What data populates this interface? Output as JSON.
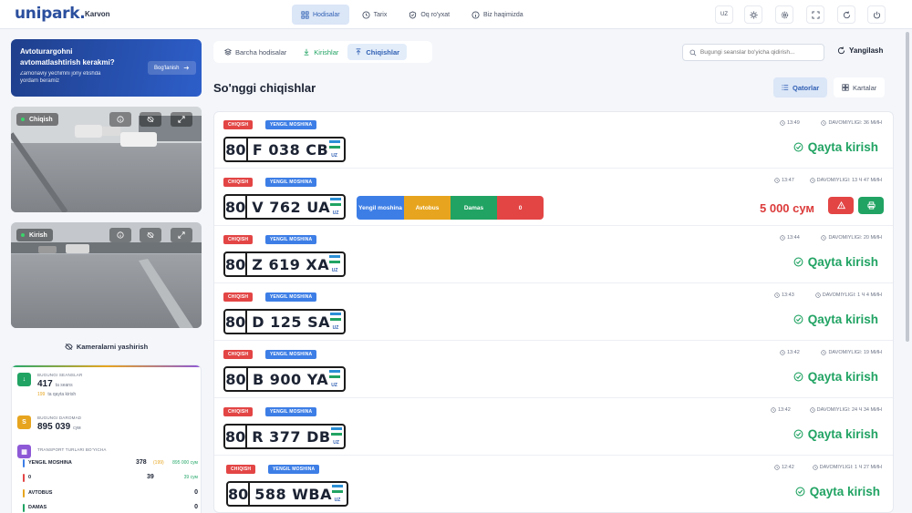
{
  "app": {
    "logo": "unipark",
    "location": "Karvon"
  },
  "nav": [
    {
      "label": "Hodisalar",
      "icon": "grid-icon",
      "active": true
    },
    {
      "label": "Tarix",
      "icon": "history-icon",
      "active": false
    },
    {
      "label": "Oq ro'yxat",
      "icon": "shield-icon",
      "active": false
    },
    {
      "label": "Biz haqimizda",
      "icon": "info-icon",
      "active": false
    }
  ],
  "topbar": {
    "lang": "UZ"
  },
  "promo": {
    "title": "Avtoturargohni avtomatlashtirish kerakmi?",
    "subtitle": "Zamonaviy yechimni joriy etishda yordam beramiz",
    "button": "Bog'lanish"
  },
  "cameras": [
    {
      "label": "Chiqish"
    },
    {
      "label": "Kirish"
    }
  ],
  "hide_cameras": "Kameralarni yashirish",
  "stats": {
    "sessions": {
      "caption": "BUGUNGI SEANSLAR",
      "value": "417",
      "unit": "ta seans",
      "sub_value": "199",
      "sub_label": "ta qayta kirish"
    },
    "income": {
      "caption": "BUGUNGI DAROMAD",
      "value": "895 039",
      "unit": "сум"
    },
    "transport": {
      "caption": "TRANSPORT TURLARI BO'YICHA",
      "rows": [
        {
          "name": "YENGIL MOSHINA",
          "count": "378",
          "extra": "(199)",
          "sum": "895 000 сум",
          "color": "#3d7ee6"
        },
        {
          "name": "0",
          "count": "39",
          "sum": "39 сум",
          "color": "#e34545"
        },
        {
          "name": "AVTOBUS",
          "count": "0",
          "color": "#e7a51f"
        },
        {
          "name": "DAMAS",
          "count": "0",
          "color": "#21a363"
        }
      ]
    }
  },
  "filters": [
    {
      "label": "Barcha hodisalar",
      "icon": "layers-icon",
      "active": false
    },
    {
      "label": "Kirishlar",
      "icon": "arrow-down-icon",
      "active": false
    },
    {
      "label": "Chiqishlar",
      "icon": "arrow-up-icon",
      "active": true
    }
  ],
  "search": {
    "placeholder": "Bugungi seanslar bo'yicha qidirish..."
  },
  "refresh": "Yangilash",
  "section_title": "So'nggi chiqishlar",
  "views": [
    {
      "label": "Qatorlar",
      "icon": "list-icon",
      "active": true
    },
    {
      "label": "Kartalar",
      "icon": "cards-icon",
      "active": false
    }
  ],
  "events": [
    {
      "badge_dir": "CHIQISH",
      "badge_type": "YENGIL MOSHINA",
      "region": "80",
      "number": "F 038 CB",
      "time": "13:49",
      "duration": "DAVOMIYLIGI: 36 МИН",
      "status": "Qayta kirish"
    },
    {
      "badge_dir": "CHIQISH",
      "badge_type": "YENGIL MOSHINA",
      "region": "80",
      "number": "V 762 UA",
      "time": "13:47",
      "duration": "DAVOMIYLIGI: 13 Ч 47 МИН",
      "types": [
        {
          "label": "Yengil moshina",
          "color": "#3d7ee6"
        },
        {
          "label": "Avtobus",
          "color": "#e7a51f"
        },
        {
          "label": "Damas",
          "color": "#21a363"
        },
        {
          "label": "0",
          "color": "#e34545"
        }
      ],
      "price": "5 000 сум"
    },
    {
      "badge_dir": "CHIQISH",
      "badge_type": "YENGIL MOSHINA",
      "region": "80",
      "number": "Z 619 XA",
      "time": "13:44",
      "duration": "DAVOMIYLIGI: 20 МИН",
      "status": "Qayta kirish"
    },
    {
      "badge_dir": "CHIQISH",
      "badge_type": "YENGIL MOSHINA",
      "region": "80",
      "number": "D 125 SA",
      "time": "13:43",
      "duration": "DAVOMIYLIGI: 1 Ч 4 МИН",
      "status": "Qayta kirish"
    },
    {
      "badge_dir": "CHIQISH",
      "badge_type": "YENGIL MOSHINA",
      "region": "80",
      "number": "B 900 YA",
      "time": "13:42",
      "duration": "DAVOMIYLIGI: 19 МИН",
      "status": "Qayta kirish"
    },
    {
      "badge_dir": "CHIQISH",
      "badge_type": "YENGIL MOSHINA",
      "region": "80",
      "number": "R 377 DB",
      "time": "13:42",
      "duration": "DAVOMIYLIGI: 24 Ч 34 МИН",
      "status": "Qayta kirish"
    },
    {
      "badge_dir": "CHIQISH",
      "badge_type": "YENGIL MOSHINA",
      "region": "80",
      "number": "588 WBA",
      "time": "12:42",
      "duration": "DAVOMIYLIGI: 1 Ч 27 МИН",
      "status": "Qayta kirish"
    }
  ],
  "plate_flag_text": "UZ",
  "colors": {
    "brand": "#2b4f9e",
    "accent": "#2f5fb3",
    "green": "#21a363",
    "red": "#dc3b3b"
  }
}
